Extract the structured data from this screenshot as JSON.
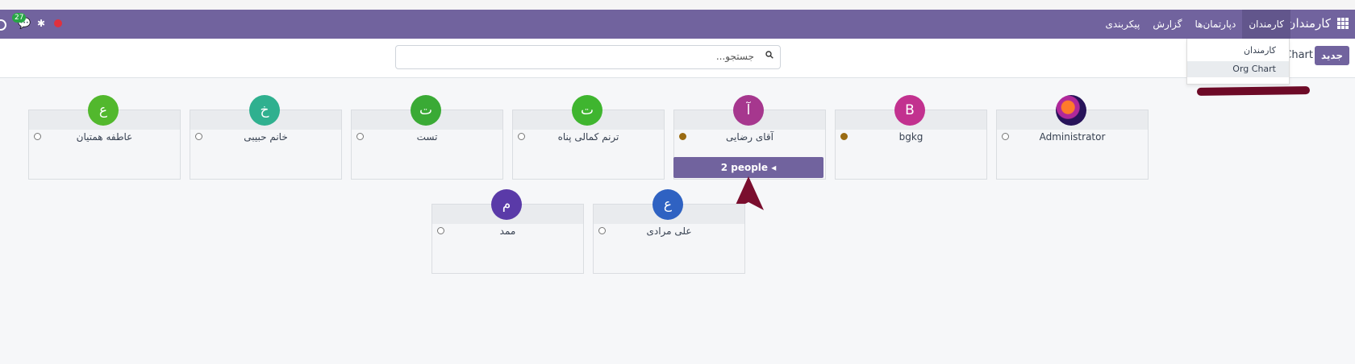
{
  "navbar": {
    "brand": "کارمندان",
    "menu": [
      "کارمندان",
      "دپارتمان‌ها",
      "گزارش",
      "پیکربندی"
    ],
    "message_count": "27",
    "accent_color": "#71639e"
  },
  "control": {
    "new_label": "جدید",
    "breadcrumb": "Chart",
    "search_placeholder": "جستجو..."
  },
  "view_dropdown": {
    "items": [
      "کارمندان",
      "Org Chart"
    ],
    "selected": "Org Chart"
  },
  "org_chart": {
    "row1": [
      {
        "initial": "",
        "name": "Administrator",
        "status": "offline",
        "avatar": "image"
      },
      {
        "initial": "B",
        "name": "bgkg",
        "status": "away",
        "color": "#c2318f"
      },
      {
        "initial": "آ",
        "name": "آقای رضایی",
        "status": "away",
        "color": "#a6378e"
      },
      {
        "initial": "ت",
        "name": "ترنم کمالی پناه",
        "status": "offline",
        "color": "#3fb52f"
      },
      {
        "initial": "ت",
        "name": "تست",
        "status": "offline",
        "color": "#3aaa35"
      },
      {
        "initial": "خ",
        "name": "خانم حبیبی",
        "status": "offline",
        "color": "#2fb08f"
      },
      {
        "initial": "ع",
        "name": "عاطفه همتیان",
        "status": "offline",
        "color": "#52b82d"
      }
    ],
    "subordinates_label": "2 people",
    "row2": [
      {
        "initial": "ع",
        "name": "علی مرادی",
        "status": "offline",
        "color": "#2f62c2"
      },
      {
        "initial": "م",
        "name": "ممد",
        "status": "offline",
        "color": "#5a3aa8"
      }
    ]
  }
}
